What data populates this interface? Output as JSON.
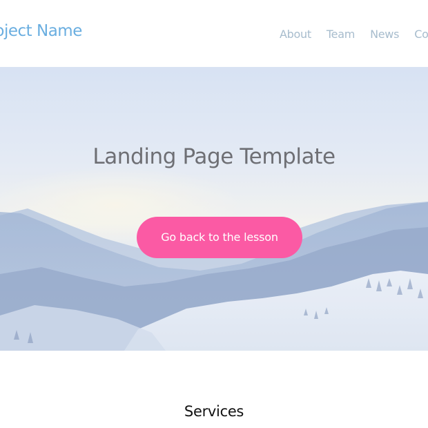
{
  "header": {
    "brand": "Project Name",
    "nav": [
      {
        "label": "About"
      },
      {
        "label": "Team"
      },
      {
        "label": "News"
      },
      {
        "label": "Contact"
      }
    ]
  },
  "hero": {
    "title": "Landing Page Template",
    "cta_label": "Go back to the lesson",
    "background": "snowy-mountain-landscape"
  },
  "services": {
    "title": "Services"
  },
  "colors": {
    "brand": "#6aaee0",
    "nav": "#a7bccd",
    "accent": "#fb5aa4",
    "hero_title": "#6e6f74"
  }
}
